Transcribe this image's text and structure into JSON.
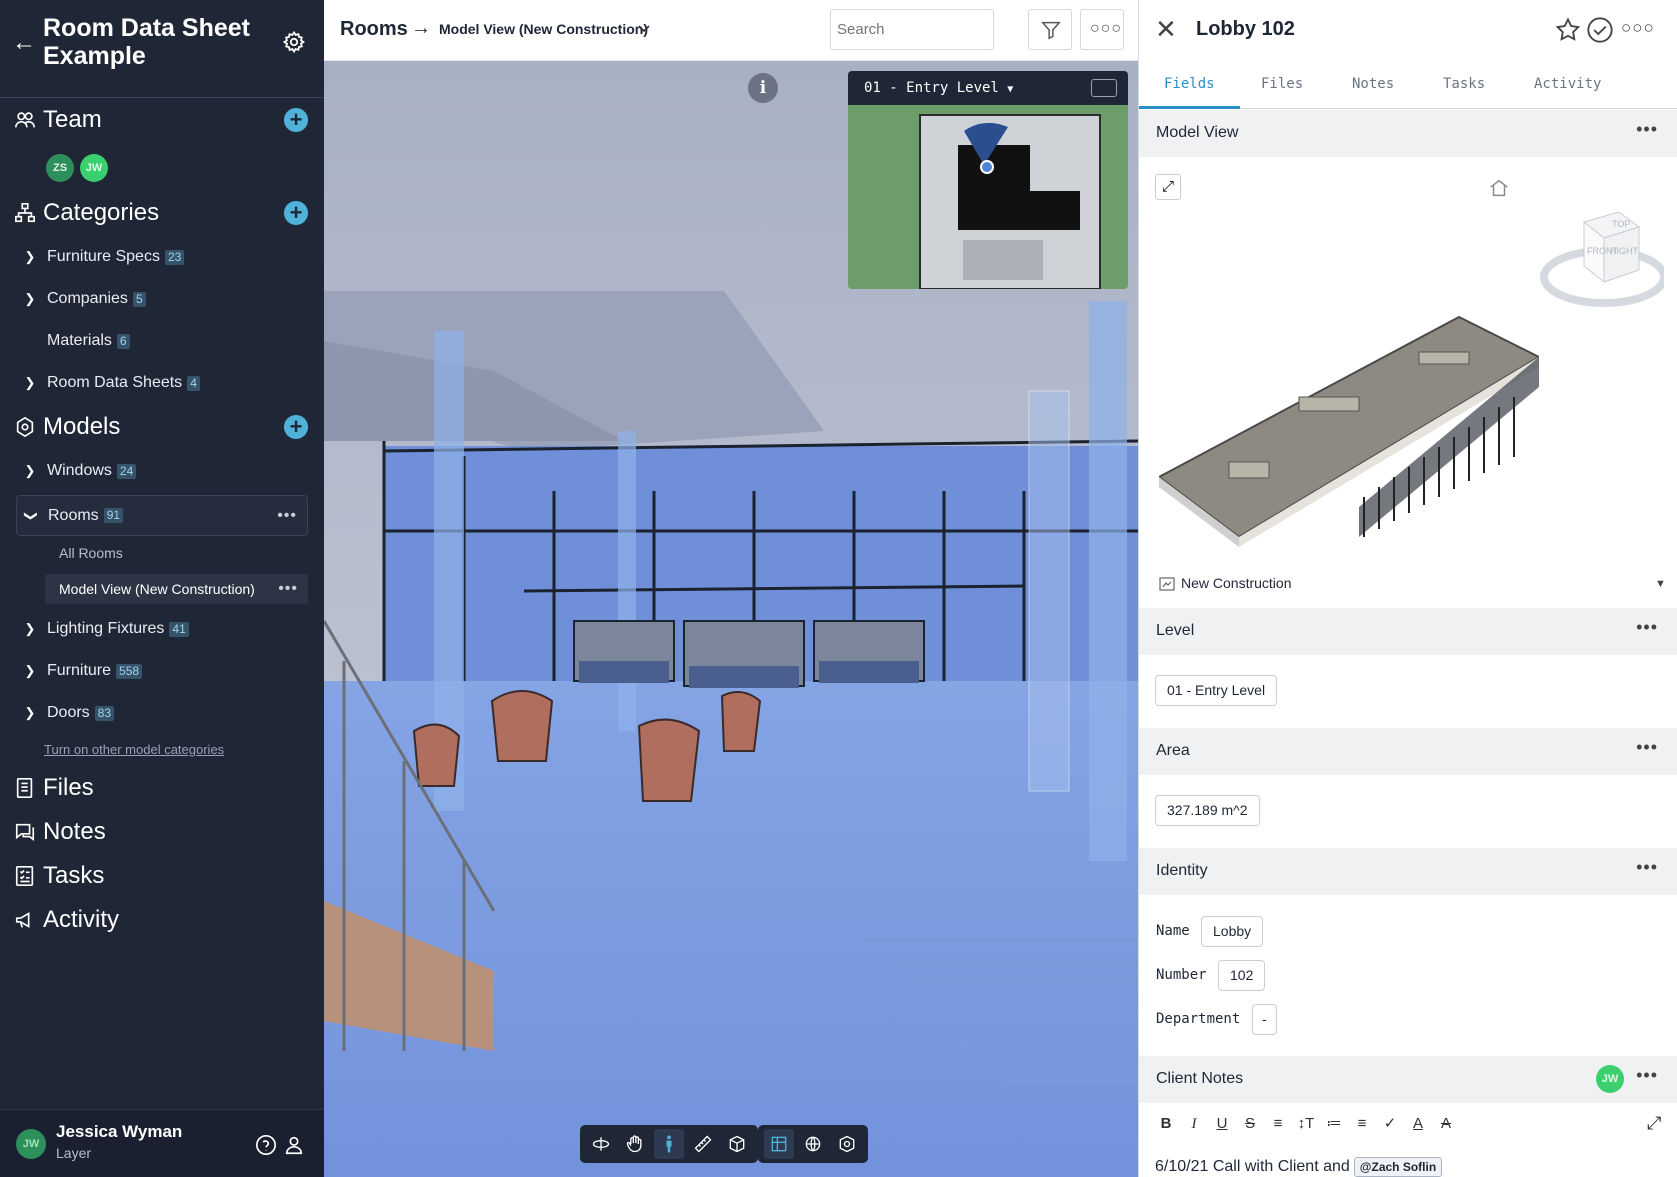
{
  "project": {
    "title": "Room Data Sheet Example"
  },
  "sidebar": {
    "team_label": "Team",
    "team_avatars": [
      {
        "initials": "ZS",
        "color": "#2d8f5a"
      },
      {
        "initials": "JW",
        "color": "#3ccf6e"
      }
    ],
    "categories_label": "Categories",
    "categories": [
      {
        "label": "Furniture Specs",
        "count": "23"
      },
      {
        "label": "Companies",
        "count": "5"
      },
      {
        "label": "Materials",
        "count": "6"
      },
      {
        "label": "Room Data Sheets",
        "count": "4"
      }
    ],
    "models_label": "Models",
    "models": [
      {
        "label": "Windows",
        "count": "24"
      },
      {
        "label": "Rooms",
        "count": "91"
      },
      {
        "label": "Lighting Fixtures",
        "count": "41"
      },
      {
        "label": "Furniture",
        "count": "558"
      },
      {
        "label": "Doors",
        "count": "83"
      }
    ],
    "room_views": [
      {
        "label": "All Rooms"
      },
      {
        "label": "Model View (New Construction)"
      }
    ],
    "other_categories_link": "Turn on other model categories",
    "files_label": "Files",
    "notes_label": "Notes",
    "tasks_label": "Tasks",
    "activity_label": "Activity",
    "user": {
      "initials": "JW",
      "name": "Jessica Wyman",
      "org": "Layer"
    }
  },
  "header": {
    "breadcrumb_root": "Rooms",
    "breadcrumb_arrow": "→",
    "view_name": "Model View (New Construction)",
    "search_placeholder": "Search"
  },
  "viewer": {
    "level_select": "01 - Entry Level",
    "info_glyph": "i"
  },
  "panel": {
    "title": "Lobby 102",
    "tabs": [
      "Fields",
      "Files",
      "Notes",
      "Tasks",
      "Activity"
    ],
    "active_tab": "Fields",
    "model_view_label": "Model View",
    "phase": "New Construction",
    "viewcube": {
      "top": "TOP",
      "front": "FRONT",
      "right": "RIGHT"
    },
    "level_label": "Level",
    "level_value": "01 - Entry Level",
    "area_label": "Area",
    "area_value": "327.189 m^2",
    "identity_label": "Identity",
    "fields": [
      {
        "label": "Name",
        "value": "Lobby"
      },
      {
        "label": "Number",
        "value": "102"
      },
      {
        "label": "Department",
        "value": "-"
      }
    ],
    "client_notes_label": "Client Notes",
    "client_notes_avatar": "JW",
    "note_text": "6/10/21 Call with Client and",
    "note_mention": "@Zach Soflin"
  },
  "colors": {
    "sidebar_bg": "#1f2636",
    "accent": "#2a8fc7",
    "add_button": "#4fb3d9",
    "viewport_floor": "#7a9ee6"
  }
}
